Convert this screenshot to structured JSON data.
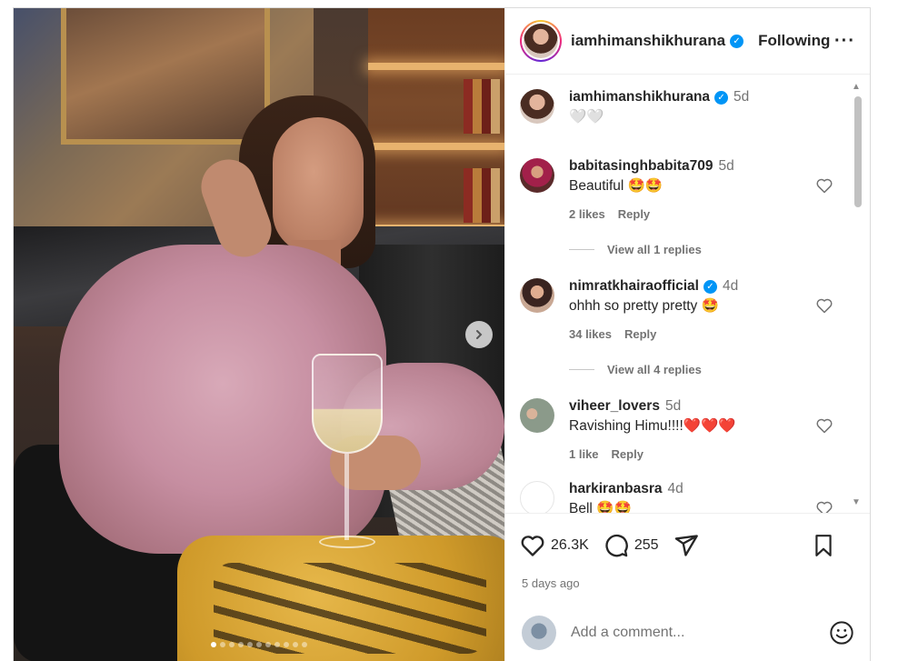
{
  "post": {
    "author": "iamhimanshikhurana",
    "follow_state": "Following",
    "more_label": "···",
    "media_dots": 11,
    "media_active_dot": 0
  },
  "caption": {
    "user": "iamhimanshikhurana",
    "time": "5d",
    "text": "🤍🤍"
  },
  "comments": [
    {
      "user": "babitasinghbabita709",
      "verified": false,
      "time": "5d",
      "text": "Beautiful 🤩🤩",
      "likes": "2 likes",
      "reply": "Reply",
      "view_replies": "View all 1 replies"
    },
    {
      "user": "nimratkhairaofficial",
      "verified": true,
      "time": "4d",
      "text": "ohhh so pretty pretty 🤩",
      "likes": "34 likes",
      "reply": "Reply",
      "view_replies": "View all 4 replies"
    },
    {
      "user": "viheer_lovers",
      "verified": false,
      "time": "5d",
      "text": "Ravishing Himu!!!!❤️❤️❤️",
      "likes": "1 like",
      "reply": "Reply",
      "view_replies": ""
    },
    {
      "user": "harkiranbasra",
      "verified": false,
      "time": "4d",
      "text": "Bell 🤩🤩",
      "likes": "",
      "reply": "",
      "view_replies": ""
    }
  ],
  "actions": {
    "likes_count": "26.3K",
    "comments_count": "255"
  },
  "time_ago": "5 days ago",
  "composer": {
    "placeholder": "Add a comment..."
  },
  "colors": {
    "verified": "#0095f6",
    "text": "#262626",
    "muted": "#737373"
  }
}
